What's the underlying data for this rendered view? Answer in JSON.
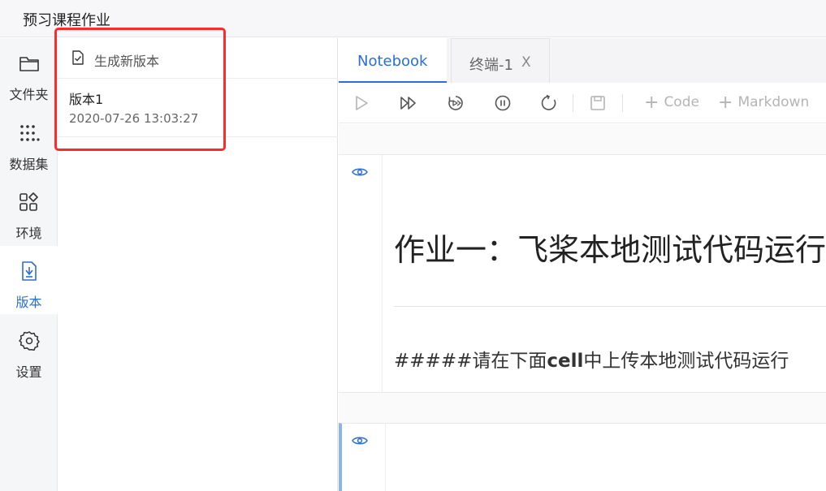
{
  "app": {
    "title": "预习课程作业"
  },
  "nav": {
    "items": [
      {
        "label": "文件夹",
        "icon": "folder-icon"
      },
      {
        "label": "数据集",
        "icon": "dataset-icon"
      },
      {
        "label": "环境",
        "icon": "environment-icon"
      },
      {
        "label": "版本",
        "icon": "version-icon",
        "active": true
      },
      {
        "label": "设置",
        "icon": "gear-icon"
      }
    ]
  },
  "versions": {
    "generate_label": "生成新版本",
    "list": [
      {
        "name": "版本1",
        "time": "2020-07-26 13:03:27"
      }
    ]
  },
  "editor": {
    "tabs": [
      {
        "label": "Notebook",
        "active": true
      },
      {
        "label": "终端-1",
        "close": "X"
      }
    ],
    "toolbar": {
      "add_code": "Code",
      "add_markdown": "Markdown"
    },
    "cells": [
      {
        "heading": "作业一：飞桨本地测试代码运行",
        "para_prefix": "#####请在下面",
        "para_bold": "cell",
        "para_suffix": "中上传本地测试代码运行"
      },
      {}
    ]
  },
  "colors": {
    "accent": "#2b6fd6",
    "highlight_border": "#ff2a2a",
    "active_cell_border": "#8ab4f0"
  }
}
